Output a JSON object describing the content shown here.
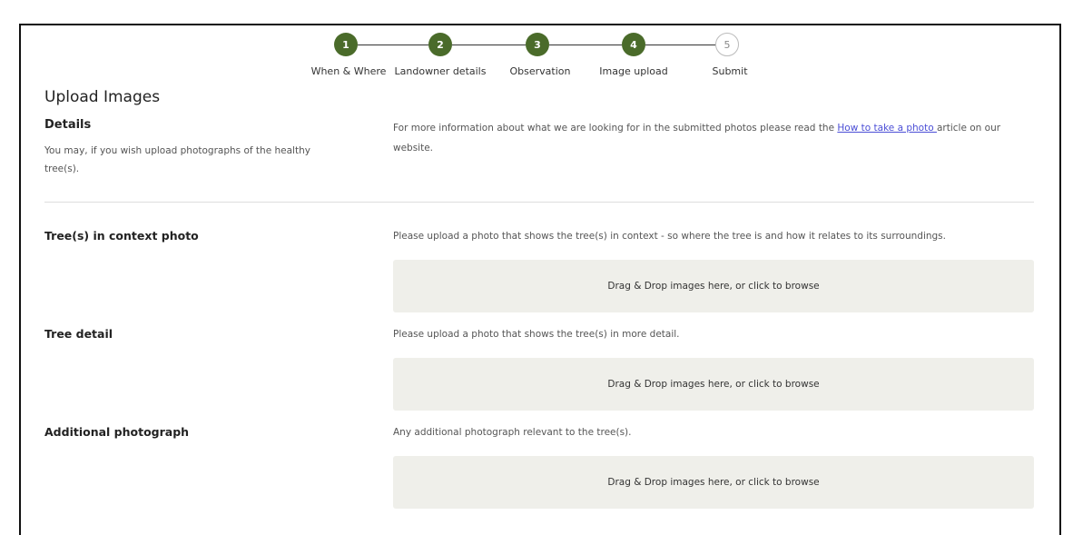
{
  "stepper": {
    "steps": [
      {
        "number": "1",
        "label": "When & Where",
        "state": "done"
      },
      {
        "number": "2",
        "label": "Landowner details",
        "state": "done"
      },
      {
        "number": "3",
        "label": "Observation",
        "state": "done"
      },
      {
        "number": "4",
        "label": "Image upload",
        "state": "current"
      },
      {
        "number": "5",
        "label": "Submit",
        "state": "pending"
      }
    ]
  },
  "page": {
    "title": "Upload Images"
  },
  "details": {
    "title": "Details",
    "description": "You may, if you wish upload photographs of the healthy tree(s).",
    "info_prefix": "For more information about what we are looking for in the submitted photos please read the ",
    "info_link": "How to take a photo ",
    "info_suffix": "article on our website."
  },
  "uploads": [
    {
      "label": "Tree(s) in context photo",
      "help": "Please upload a photo that shows the tree(s) in context - so where the tree is and how it relates to its surroundings.",
      "dropzone": "Drag & Drop images here, or click to browse"
    },
    {
      "label": "Tree detail",
      "help": "Please upload a photo that shows the tree(s) in more detail.",
      "dropzone": "Drag & Drop images here, or click to browse"
    },
    {
      "label": "Additional photograph",
      "help": "Any additional photograph relevant to the tree(s).",
      "dropzone": "Drag & Drop images here, or click to browse"
    }
  ],
  "colors": {
    "accent": "#4a6b2a",
    "dropzone_bg": "#efefea",
    "link": "#4b4ed6"
  }
}
